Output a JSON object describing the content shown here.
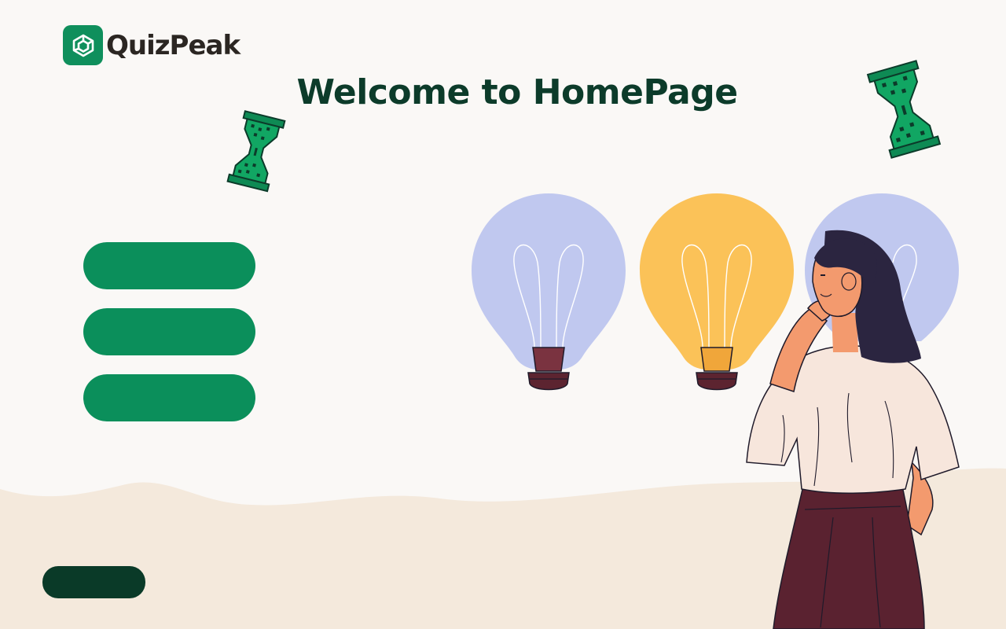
{
  "brand": {
    "name": "QuizPeak",
    "icon": "cube-logo-icon",
    "color": "#0f8f5c"
  },
  "page": {
    "title": "Welcome to HomePage"
  },
  "menu": {
    "buttons": [
      {
        "label": ""
      },
      {
        "label": ""
      },
      {
        "label": ""
      }
    ]
  },
  "footer": {
    "button_label": ""
  },
  "illustration": {
    "description_icons": [
      "hourglass-icon",
      "lightbulb-icon",
      "woman-thinking-icon"
    ]
  },
  "colors": {
    "accent": "#0b8f5b",
    "title": "#0c3b2a",
    "dark_button": "#0a3a28",
    "background": "#faf8f6",
    "wave": "#f4e9dc",
    "bulb_blue": "#c0c8ef",
    "bulb_yellow": "#fbc258"
  }
}
